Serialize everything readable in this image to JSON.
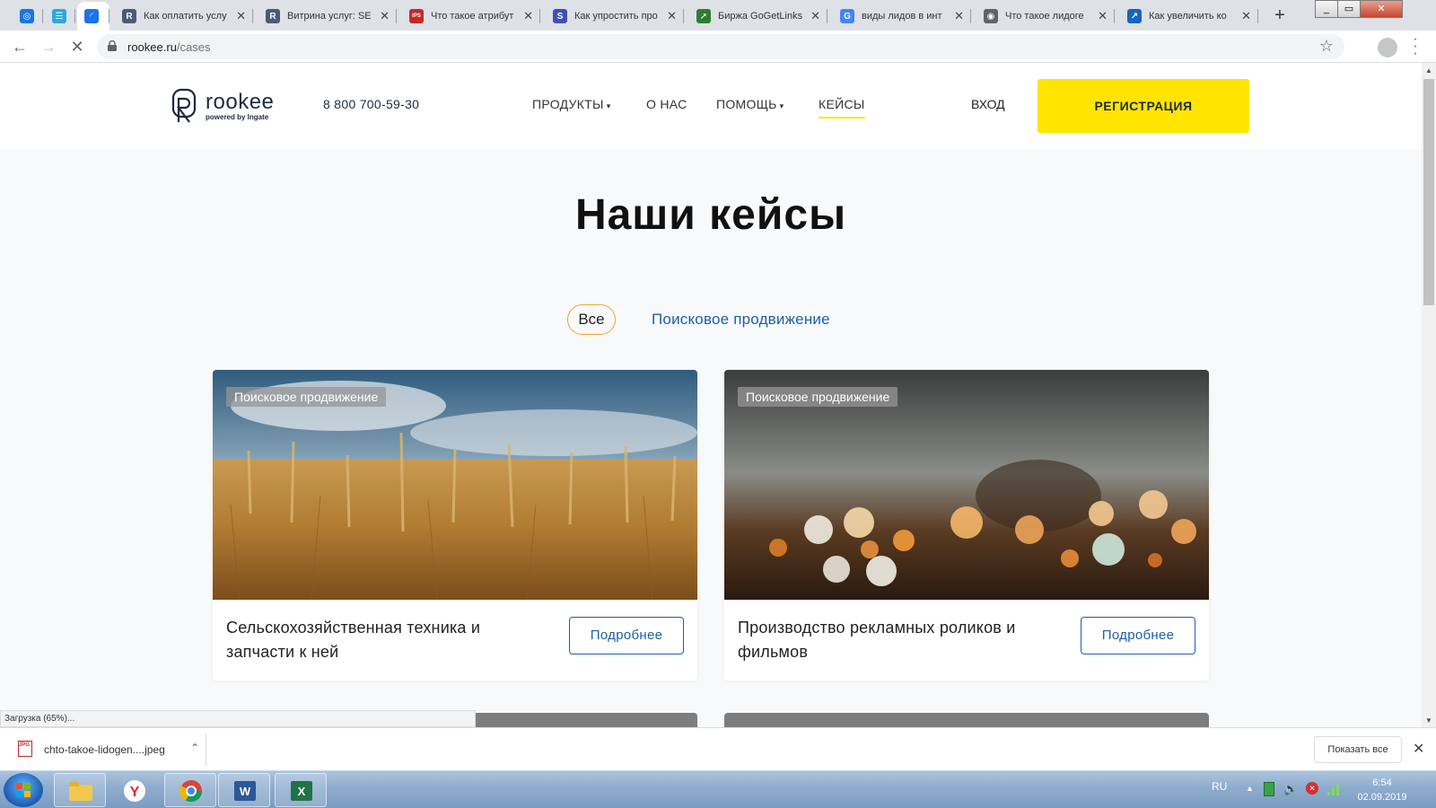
{
  "browser": {
    "tabs": [
      {
        "title": "",
        "icon": "target-icon",
        "color": "#1a73e8",
        "pinned": true
      },
      {
        "title": "",
        "icon": "chat-icon",
        "color": "#29a8e0",
        "pinned": true
      },
      {
        "title": "",
        "icon": "loading-icon",
        "color": "#1a73e8",
        "pinned": true,
        "active": true
      },
      {
        "title": "Как оплатить услу",
        "icon": "rookee-icon",
        "color": "#4a5a78"
      },
      {
        "title": "Витрина услуг: SE",
        "icon": "rookee-icon",
        "color": "#4a5a78"
      },
      {
        "title": "Что такое атрибут",
        "icon": "ips-icon",
        "color": "#c62828"
      },
      {
        "title": "Как упростить про",
        "icon": "s-icon",
        "color": "#3f51b5"
      },
      {
        "title": "Биржа GoGetLinks",
        "icon": "gogetlinks-icon",
        "color": "#2e7d32"
      },
      {
        "title": "виды лидов в инт",
        "icon": "google-icon",
        "color": "#4285f4"
      },
      {
        "title": "Что такое лидоге",
        "icon": "globe-icon",
        "color": "#5f6368"
      },
      {
        "title": "Как увеличить ко",
        "icon": "chart-icon",
        "color": "#1565c0"
      }
    ],
    "url_host": "rookee.ru",
    "url_path": "/cases",
    "status_text": "Загрузка (65%)..."
  },
  "site": {
    "logo_name": "rookee",
    "logo_sub": "powered by Ingate",
    "phone": "8 800 700-59-30",
    "nav": [
      {
        "label": "ПРОДУКТЫ",
        "dropdown": true
      },
      {
        "label": "О НАС",
        "dropdown": false
      },
      {
        "label": "ПОМОЩЬ",
        "dropdown": true
      },
      {
        "label": "КЕЙСЫ",
        "dropdown": false,
        "active": true
      }
    ],
    "login_label": "ВХОД",
    "register_label": "РЕГИСТРАЦИЯ",
    "accent_color": "#ffe500",
    "link_color": "#1c5fa8"
  },
  "main": {
    "title": "Наши кейсы",
    "filters": [
      "Все",
      "Поисковое продвижение"
    ],
    "cards": [
      {
        "tag": "Поисковое продвижение",
        "title": "Сельскохозяйственная техника и запчасти к ней",
        "button": "Подробнее",
        "image": "wheat-field"
      },
      {
        "tag": "Поисковое продвижение",
        "title": "Производство рекламных роликов и фильмов",
        "button": "Подробнее",
        "image": "bokeh-lights"
      }
    ]
  },
  "downloads": {
    "file_name": "chto-takoe-lidogen....jpeg",
    "file_badge": "JPG",
    "show_all_label": "Показать все"
  },
  "taskbar": {
    "lang": "RU",
    "time": "6:54",
    "date": "02.09.2019"
  }
}
